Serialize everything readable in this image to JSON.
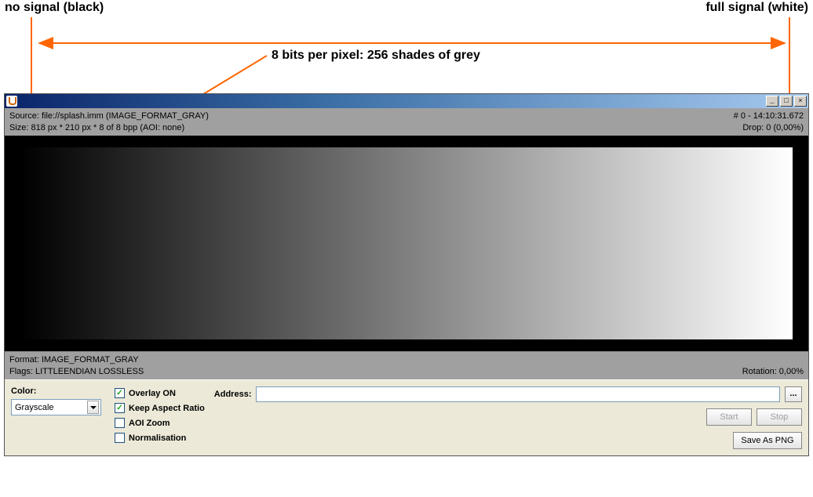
{
  "annotations": {
    "left_label": "no signal (black)",
    "right_label": "full signal (white)",
    "center_label": "8 bits per pixel: 256 shades of grey"
  },
  "window": {
    "buttons": {
      "minimize": "_",
      "maximize": "□",
      "close": "×"
    }
  },
  "info_bar": {
    "source": "Source: file://splash.imm (IMAGE_FORMAT_GRAY)",
    "size": "Size: 818 px * 210 px * 8 of 8 bpp   (AOI: none)",
    "frame": "# 0 - 14:10:31.672",
    "drop": "Drop: 0 (0,00%)"
  },
  "footer": {
    "format": "Format: IMAGE_FORMAT_GRAY",
    "flags": "Flags: LITTLEENDIAN LOSSLESS",
    "rotation": "Rotation: 0,00%"
  },
  "controls": {
    "color_label": "Color:",
    "color_value": "Grayscale",
    "overlay": "Overlay ON",
    "keep_aspect": "Keep Aspect Ratio",
    "aoi_zoom": "AOI Zoom",
    "normalisation": "Normalisation",
    "address_label": "Address:",
    "address_value": "",
    "browse": "...",
    "start": "Start",
    "stop": "Stop",
    "save_png": "Save As PNG"
  },
  "checked": {
    "overlay": true,
    "keep_aspect": true,
    "aoi_zoom": false,
    "normalisation": false
  },
  "colors": {
    "arrow": "#ff6600"
  }
}
